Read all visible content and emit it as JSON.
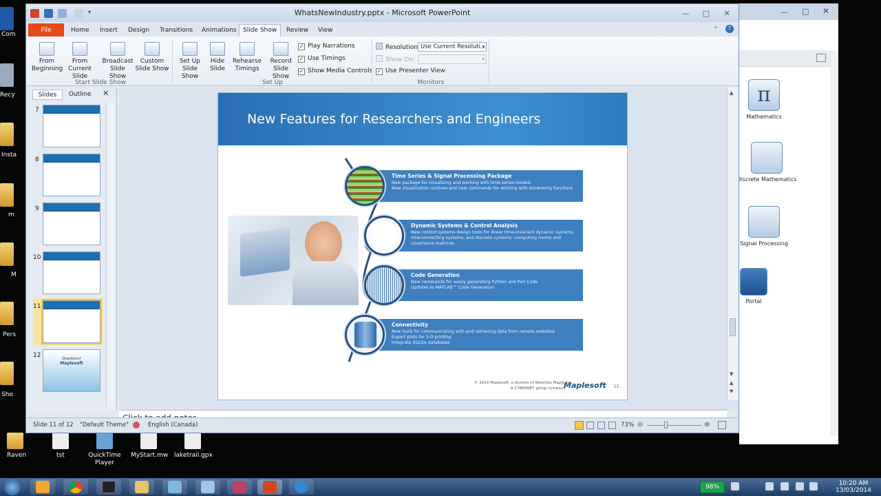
{
  "window": {
    "title": "WhatsNewIndustry.pptx - Microsoft PowerPoint"
  },
  "ribbon": {
    "tabs": [
      "File",
      "Home",
      "Insert",
      "Design",
      "Transitions",
      "Animations",
      "Slide Show",
      "Review",
      "View"
    ],
    "active_tab": "Slide Show",
    "groups": {
      "start": {
        "label": "Start Slide Show",
        "buttons": [
          {
            "line1": "From",
            "line2": "Beginning"
          },
          {
            "line1": "From",
            "line2": "Current Slide"
          },
          {
            "line1": "Broadcast",
            "line2": "Slide Show"
          },
          {
            "line1": "Custom",
            "line2": "Slide Show"
          }
        ]
      },
      "setup": {
        "label": "Set Up",
        "buttons": [
          {
            "line1": "Set Up",
            "line2": "Slide Show"
          },
          {
            "line1": "Hide",
            "line2": "Slide"
          },
          {
            "line1": "Rehearse",
            "line2": "Timings"
          },
          {
            "line1": "Record",
            "line2": "Slide Show"
          }
        ],
        "checkboxes": [
          {
            "label": "Play Narrations",
            "checked": true
          },
          {
            "label": "Use Timings",
            "checked": true
          },
          {
            "label": "Show Media Controls",
            "checked": true
          }
        ]
      },
      "monitors": {
        "label": "Monitors",
        "resolution_label": "Resolution:",
        "resolution_value": "Use Current Resoluti...",
        "show_on_label": "Show On:",
        "show_on_value": "",
        "presenter_view_label": "Use Presenter View",
        "presenter_view_checked": true
      }
    }
  },
  "side_panel": {
    "tabs": [
      "Slides",
      "Outline"
    ],
    "active_tab": "Slides",
    "slides": [
      {
        "num": "7"
      },
      {
        "num": "8"
      },
      {
        "num": "9"
      },
      {
        "num": "10"
      },
      {
        "num": "11",
        "selected": true
      },
      {
        "num": "12",
        "caption": "Questions?",
        "brand": "Maplesoft"
      }
    ]
  },
  "slide": {
    "title": "New Features for Researchers and Engineers",
    "features": [
      {
        "title": "Time Series & Signal Processing Package",
        "bullets": [
          "New package for visualizing and working with time series models",
          "New visualization routines and new commands for working with windowing functions"
        ]
      },
      {
        "title": "Dynamic Systems & Control Analysis",
        "bullets": [
          "New control systems design tools for linear time-invariant dynamic systems, interconnecting systems, and discrete systems; computing norms and covariance matrices"
        ]
      },
      {
        "title": "Code Generation",
        "bullets": [
          "New commands for easily generating Python and Perl Code",
          "Updates to MATLAB™ Code Generation"
        ]
      },
      {
        "title": "Connectivity",
        "bullets": [
          "New tools for communicating with and retrieving data from remote websites",
          "Export plots for 3-D printing",
          "Integrate SQLite databases"
        ]
      }
    ],
    "footer": "© 2014 Maplesoft, a division of Waterloo Maple Inc.",
    "footer2": "A CYBERNET group company",
    "brand": "Maplesoft",
    "page_number": "11"
  },
  "notes_placeholder": "Click to add notes",
  "status_bar": {
    "slide_info": "Slide 11 of 12",
    "theme": "\"Default Theme\"",
    "language": "English (Canada)",
    "zoom": "73%"
  },
  "maple_palettes": [
    "Mathematics",
    "Discrete Mathematics",
    "Signal Processing",
    "Portal"
  ],
  "desktop_icons": [
    "Raven",
    "tst",
    "QuickTime Player",
    "MyStart.mw",
    "laketrail.gpx"
  ],
  "desktop_left_labels": [
    "Com",
    "Recy",
    "Insta",
    "m",
    "M",
    "Pers",
    "Sho"
  ],
  "taskbar": {
    "battery": "98%",
    "time": "10:20 AM",
    "date": "13/03/2014"
  },
  "colors": {
    "slide_band": "#2a6fb4",
    "feature_bar": "#3e7fbf",
    "file_tab": "#e64a19"
  }
}
